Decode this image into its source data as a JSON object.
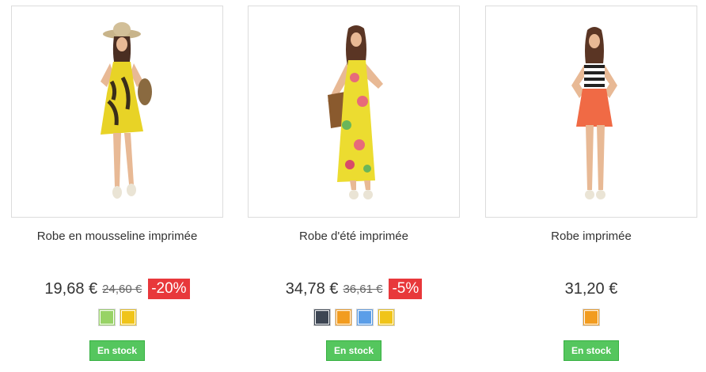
{
  "products": [
    {
      "name": "Robe en mousseline imprimée",
      "price": "19,68 €",
      "old_price": "24,60 €",
      "discount": "-20%",
      "colors": [
        "#98d366",
        "#f0c419"
      ],
      "availability": "En stock",
      "image": "woman-in-yellow-printed-chiffon-dress-with-hat"
    },
    {
      "name": "Robe d'été imprimée",
      "price": "34,78 €",
      "old_price": "36,61 €",
      "discount": "-5%",
      "colors": [
        "#3d4653",
        "#f29c1f",
        "#5b9ee8",
        "#f0c419"
      ],
      "availability": "En stock",
      "image": "woman-in-yellow-floral-maxi-dress-with-bag"
    },
    {
      "name": "Robe imprimée",
      "price": "31,20 €",
      "old_price": null,
      "discount": null,
      "colors": [
        "#f29c1f"
      ],
      "availability": "En stock",
      "image": "woman-in-striped-top-and-orange-skirt"
    }
  ]
}
